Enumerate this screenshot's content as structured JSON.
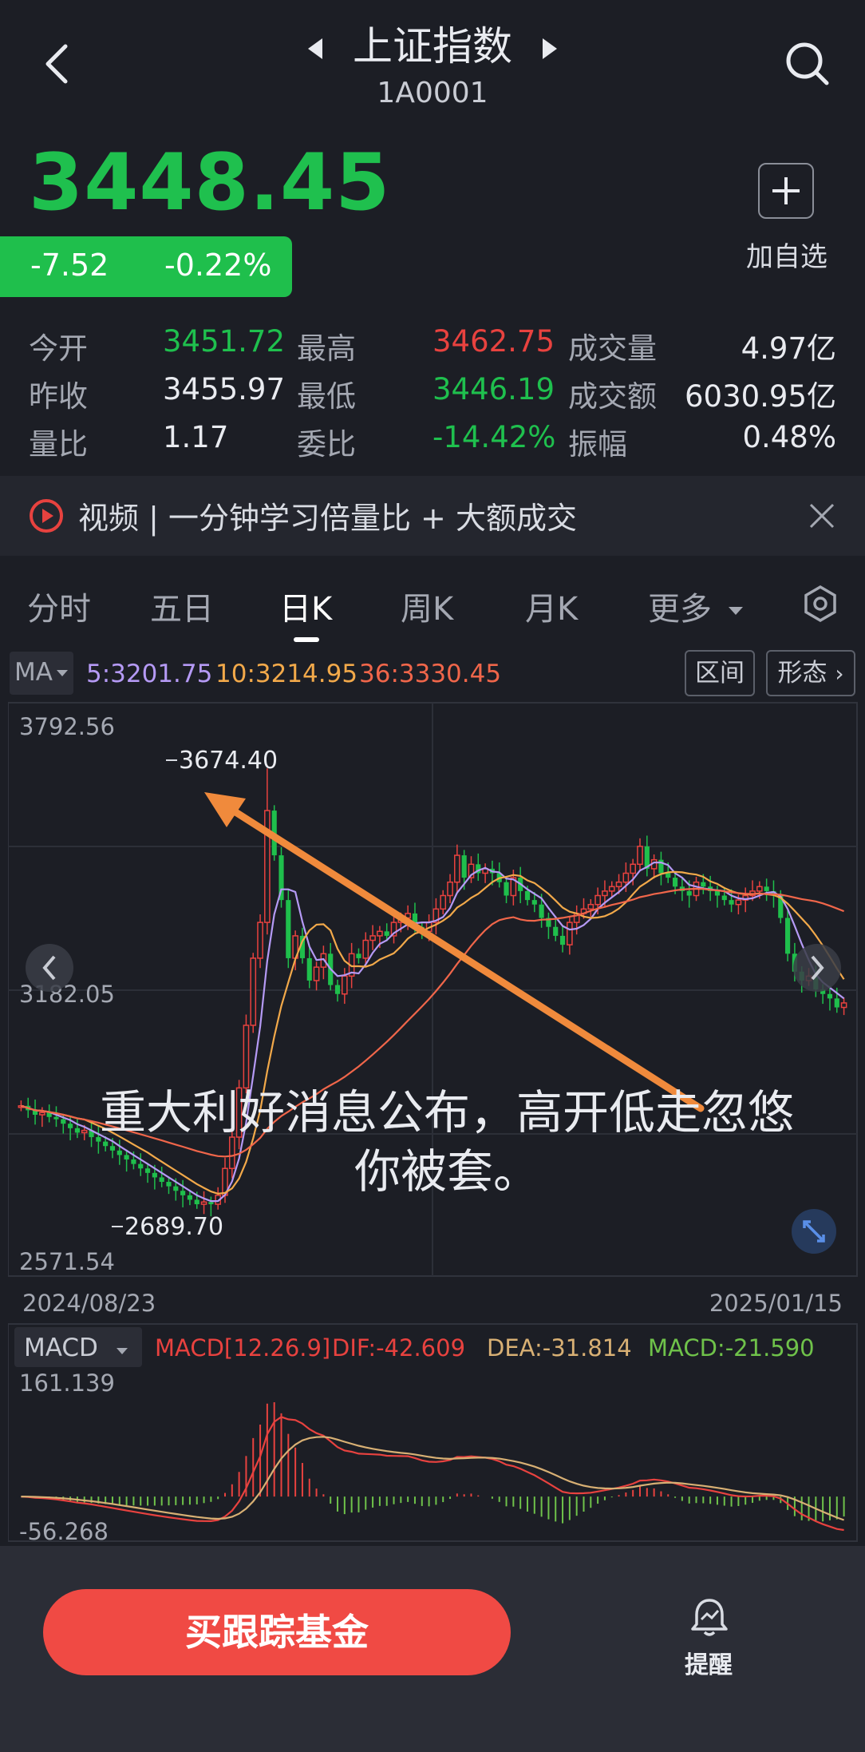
{
  "header": {
    "title": "上证指数",
    "code": "1A0001"
  },
  "quote": {
    "price": "3448.45",
    "change": "-7.52",
    "change_pct": "-0.22%",
    "add_watch_label": "加自选"
  },
  "stats": [
    {
      "label": "今开",
      "value": "3451.72",
      "color": "#1fc04e"
    },
    {
      "label": "最高",
      "value": "3462.75",
      "color": "#e8423f"
    },
    {
      "label": "成交量",
      "value": "4.97亿",
      "color": "#e9ebf0"
    },
    {
      "label": "昨收",
      "value": "3455.97",
      "color": "#e9ebf0"
    },
    {
      "label": "最低",
      "value": "3446.19",
      "color": "#1fc04e"
    },
    {
      "label": "成交额",
      "value": "6030.95亿",
      "color": "#e9ebf0"
    },
    {
      "label": "量比",
      "value": "1.17",
      "color": "#e9ebf0"
    },
    {
      "label": "委比",
      "value": "-14.42%",
      "color": "#1fc04e"
    },
    {
      "label": "振幅",
      "value": "0.48%",
      "color": "#e9ebf0"
    }
  ],
  "banner": {
    "text": "视频 | 一分钟学习倍量比 + 大额成交"
  },
  "tabs": [
    {
      "label": "分时",
      "active": false
    },
    {
      "label": "五日",
      "active": false
    },
    {
      "label": "日K",
      "active": true
    },
    {
      "label": "周K",
      "active": false
    },
    {
      "label": "月K",
      "active": false
    },
    {
      "label": "更多",
      "active": false
    }
  ],
  "ma_bar": {
    "selector": "MA",
    "ma5": "5:3201.75",
    "ma10": "10:3214.95",
    "ma36": "36:3330.45",
    "range_btn": "区间",
    "pattern_btn": "形态"
  },
  "kline": {
    "y_top": "3792.56",
    "y_mid": "3182.05",
    "y_bottom": "2571.54",
    "high_label": "3674.40",
    "low_label": "2689.70",
    "date_start": "2024/08/23",
    "date_end": "2025/01/15",
    "overlay_line1": "重大利好消息公布，高开低走忽悠",
    "overlay_line2": "你被套。"
  },
  "macd": {
    "selector": "MACD",
    "params": "MACD[12.26.9]",
    "dif": "DIF:-42.609",
    "dea": "DEA:-31.814",
    "macd": "MACD:-21.590",
    "y_top": "161.139",
    "y_bottom": "-56.268"
  },
  "chart_data": {
    "type": "candlestick",
    "y_range": [
      2571.54,
      3792.56
    ],
    "dates": [
      "2024/08/23",
      "2025/01/15"
    ],
    "annotations": {
      "high": 3674.4,
      "low": 2689.7
    },
    "close_series": [
      2920,
      2910,
      2900,
      2905,
      2895,
      2890,
      2880,
      2870,
      2860,
      2865,
      2850,
      2840,
      2830,
      2820,
      2810,
      2800,
      2790,
      2780,
      2770,
      2760,
      2750,
      2740,
      2730,
      2720,
      2710,
      2700,
      2705,
      2700,
      2720,
      2780,
      2850,
      2960,
      3100,
      3250,
      3330,
      3580,
      3480,
      3380,
      3250,
      3300,
      3250,
      3200,
      3230,
      3260,
      3190,
      3170,
      3210,
      3260,
      3250,
      3290,
      3300,
      3310,
      3300,
      3330,
      3340,
      3350,
      3320,
      3310,
      3330,
      3360,
      3390,
      3420,
      3480,
      3430,
      3460,
      3440,
      3450,
      3440,
      3420,
      3390,
      3430,
      3400,
      3380,
      3370,
      3340,
      3320,
      3300,
      3280,
      3330,
      3350,
      3360,
      3370,
      3390,
      3400,
      3410,
      3420,
      3440,
      3460,
      3500,
      3450,
      3470,
      3440,
      3430,
      3410,
      3400,
      3390,
      3420,
      3410,
      3400,
      3390,
      3380,
      3370,
      3380,
      3390,
      3400,
      3410,
      3400,
      3390,
      3340,
      3260,
      3220,
      3200,
      3210,
      3180,
      3170,
      3160,
      3140,
      3150
    ]
  },
  "bottom_bar": {
    "buy_label": "买跟踪基金",
    "remind_label": "提醒"
  }
}
